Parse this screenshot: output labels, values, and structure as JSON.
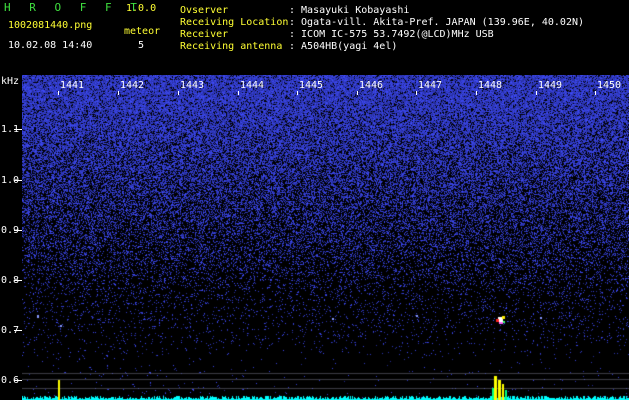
{
  "header": {
    "app_title": "H R O F F T",
    "version": "1.0.0",
    "filename": "1002081440.png",
    "datetime": "10.02.08 14:40",
    "meteor_label": "meteor",
    "meteor_count": "5",
    "observer_label": "Ovserver",
    "observer_value": ": Masayuki Kobayashi",
    "location_label": "Receiving Location",
    "location_value": ": Ogata-vill. Akita-Pref. JAPAN (139.96E, 40.02N)",
    "receiver_label": "Receiver",
    "receiver_value": ": ICOM IC-575 53.7492(@LCD)MHz USB",
    "antenna_label": "Receiving antenna",
    "antenna_value": ": A504HB(yagi 4el)"
  },
  "axes": {
    "y_unit": "kHz",
    "y_labels": [
      "1.1",
      "1.0",
      "0.9",
      "0.8",
      "0.7",
      "0.6"
    ],
    "x_labels": [
      "1441",
      "1442",
      "1443",
      "1444",
      "1445",
      "1446",
      "1447",
      "1448",
      "1449",
      "1450"
    ]
  },
  "colors": {
    "background": "#000000",
    "noise": "#2a3cff",
    "header_green": "#3fe03f",
    "header_yellow": "#ffff33",
    "trace_cyan": "#00ffff"
  }
}
